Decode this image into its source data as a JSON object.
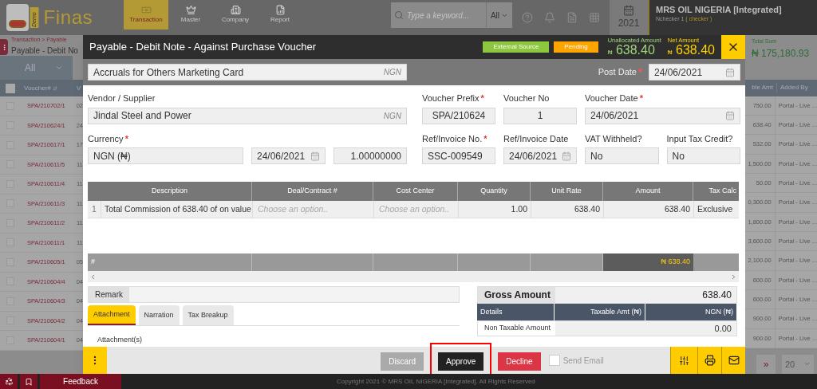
{
  "app": {
    "logo_badge": "Demo",
    "logo_name": "Finas",
    "nav": [
      {
        "label": "Transaction",
        "selected": true
      },
      {
        "label": "Master",
        "selected": false
      },
      {
        "label": "Company",
        "selected": false
      },
      {
        "label": "Report",
        "selected": false
      }
    ],
    "search": {
      "placeholder": "Type a keyword...",
      "scope": "All"
    },
    "year": "2021",
    "company": {
      "name": "MRS OIL NIGERIA [Integrated]",
      "user": "Nchecker 1",
      "role": "( checker )"
    }
  },
  "page": {
    "breadcrumb": "Transaction > Payable",
    "title": "Payable - Debit No",
    "filter": "All",
    "total_label": "Total Sum",
    "total": "₦ 175,180.93"
  },
  "list": {
    "columns": [
      "Voucher#",
      "V",
      "ble Amt",
      "Added By"
    ],
    "select_all_checked": false,
    "rows": [
      {
        "checked": false,
        "voucher": "SPA/210702/1",
        "column_2": "02",
        "amount": "750.00",
        "added_by": "Portal - Live ..."
      },
      {
        "checked": false,
        "voucher": "SPA/210624/1",
        "column_2": "24",
        "amount": "638.40",
        "added_by": "Portal - Live ..."
      },
      {
        "checked": false,
        "voucher": "SPA/210617/1",
        "column_2": "17",
        "amount": "532.00",
        "added_by": "Portal - Live ..."
      },
      {
        "checked": false,
        "voucher": "SPA/210611/5",
        "column_2": "11",
        "amount": "1,500.00",
        "added_by": "Portal - Live ..."
      },
      {
        "checked": false,
        "voucher": "SPA/210611/4",
        "column_2": "11",
        "amount": "50.00",
        "added_by": "Portal - Live ..."
      },
      {
        "checked": false,
        "voucher": "SPA/210611/3",
        "column_2": "11",
        "amount": "0,300.00",
        "added_by": "Portal - Live ..."
      },
      {
        "checked": false,
        "voucher": "SPA/210611/2",
        "column_2": "11",
        "amount": "1,800.00",
        "added_by": "Portal - Live ..."
      },
      {
        "checked": false,
        "voucher": "SPA/210611/1",
        "column_2": "11",
        "amount": "3,600.00",
        "added_by": "Portal - Live ..."
      },
      {
        "checked": false,
        "voucher": "SPA/210605/1",
        "column_2": "05",
        "amount": "2,100.00",
        "added_by": "Portal - Live ..."
      },
      {
        "checked": false,
        "voucher": "SPA/210604/4",
        "column_2": "04",
        "amount": "600.00",
        "added_by": "Portal - Live ..."
      },
      {
        "checked": false,
        "voucher": "SPA/210604/3",
        "column_2": "04",
        "amount": "600.00",
        "added_by": "Portal - Live ..."
      },
      {
        "checked": false,
        "voucher": "SPA/210604/2",
        "column_2": "04",
        "amount": "900.00",
        "added_by": "Portal - Live ..."
      },
      {
        "checked": false,
        "voucher": "SPA/210604/1",
        "column_2": "04",
        "amount": "900.00",
        "added_by": "Portal - Live ..."
      }
    ],
    "pagination": {
      "next": "»",
      "page_size": "20"
    }
  },
  "modal": {
    "title": "Payable - Debit Note - Against Purchase Voucher",
    "required_mark": "*",
    "badges": [
      {
        "label": "External Source",
        "color": "#8dc63f"
      },
      {
        "label": "Pending",
        "color": "#ffa500"
      }
    ],
    "unallocated": {
      "label": "Unallocated Amount",
      "currency": "₦",
      "value": "638.40"
    },
    "net": {
      "label": "Net Amount",
      "currency": "₦",
      "value": "638.40"
    },
    "account": {
      "value": "Accruals for Others Marketing Card",
      "suffix": "NGN"
    },
    "post_date": {
      "label": "Post Date",
      "required": true,
      "value": "24/06/2021"
    },
    "vendor": {
      "label": "Vendor / Supplier",
      "required": false,
      "value": "Jindal Steel and Power",
      "suffix": "NGN"
    },
    "currency": {
      "label": "Currency",
      "required": true,
      "value": "NGN (₦)",
      "date": "24/06/2021",
      "rate": "1.00000000"
    },
    "voucher_prefix": {
      "label": "Voucher Prefix",
      "required": true,
      "value": "SPA/210624"
    },
    "voucher_no": {
      "label": "Voucher No",
      "required": false,
      "value": "1"
    },
    "voucher_date": {
      "label": "Voucher Date",
      "required": true,
      "value": "24/06/2021"
    },
    "ref_invoice_no": {
      "label": "Ref/Invoice No.",
      "required": true,
      "value": "SSC-009549"
    },
    "ref_invoice_date": {
      "label": "Ref/Invoice Date",
      "required": false,
      "value": "24/06/2021"
    },
    "vat_withheld": {
      "label": "VAT Withheld?",
      "required": false,
      "value": "No"
    },
    "input_tax_credit": {
      "label": "Input Tax Credit?",
      "required": false,
      "value": "No"
    },
    "grid": {
      "columns": [
        "Description",
        "Deal/Contract #",
        "Cost Center",
        "Quantity",
        "Unit Rate",
        "Amount",
        "Tax Calc"
      ],
      "rows": [
        {
          "number": "1",
          "description": "Total Commission of 638.40 of on value",
          "deal_placeholder": "Choose an option..",
          "cost_placeholder": "Choose an option..",
          "quantity": "1.00",
          "unit_rate": "638.40",
          "amount": "638.40",
          "tax_calc": "Exclusive"
        }
      ],
      "footer_label": "#",
      "footer_amount": "₦ 638.40"
    },
    "remark": {
      "label": "Remark"
    },
    "tabs": [
      {
        "label": "Attachment",
        "selected": true
      },
      {
        "label": "Narration",
        "selected": false
      },
      {
        "label": "Tax Breakup",
        "selected": false
      }
    ],
    "attachment_label": "Attachment(s)",
    "summary": {
      "gross_label": "Gross Amount",
      "gross_value": "638.40",
      "columns": [
        "Details",
        "Taxable Amt (₦)",
        "NGN (₦)"
      ],
      "rows": [
        {
          "label": "Non Taxable Amount",
          "amount": "0.00"
        }
      ]
    },
    "actions": [
      {
        "label": "Discard",
        "kind": "discard",
        "highlighted": false
      },
      {
        "label": "Approve",
        "kind": "approve",
        "highlighted": true
      },
      {
        "label": "Decline",
        "kind": "decline",
        "highlighted": false
      }
    ],
    "send_email": {
      "label": "Send Email",
      "checked": false
    }
  },
  "footer": {
    "feedback": "Feedback",
    "copyright": "Copyright 2021 © MRS OIL NIGERIA [Integrated]. All Rights Reserved"
  }
}
